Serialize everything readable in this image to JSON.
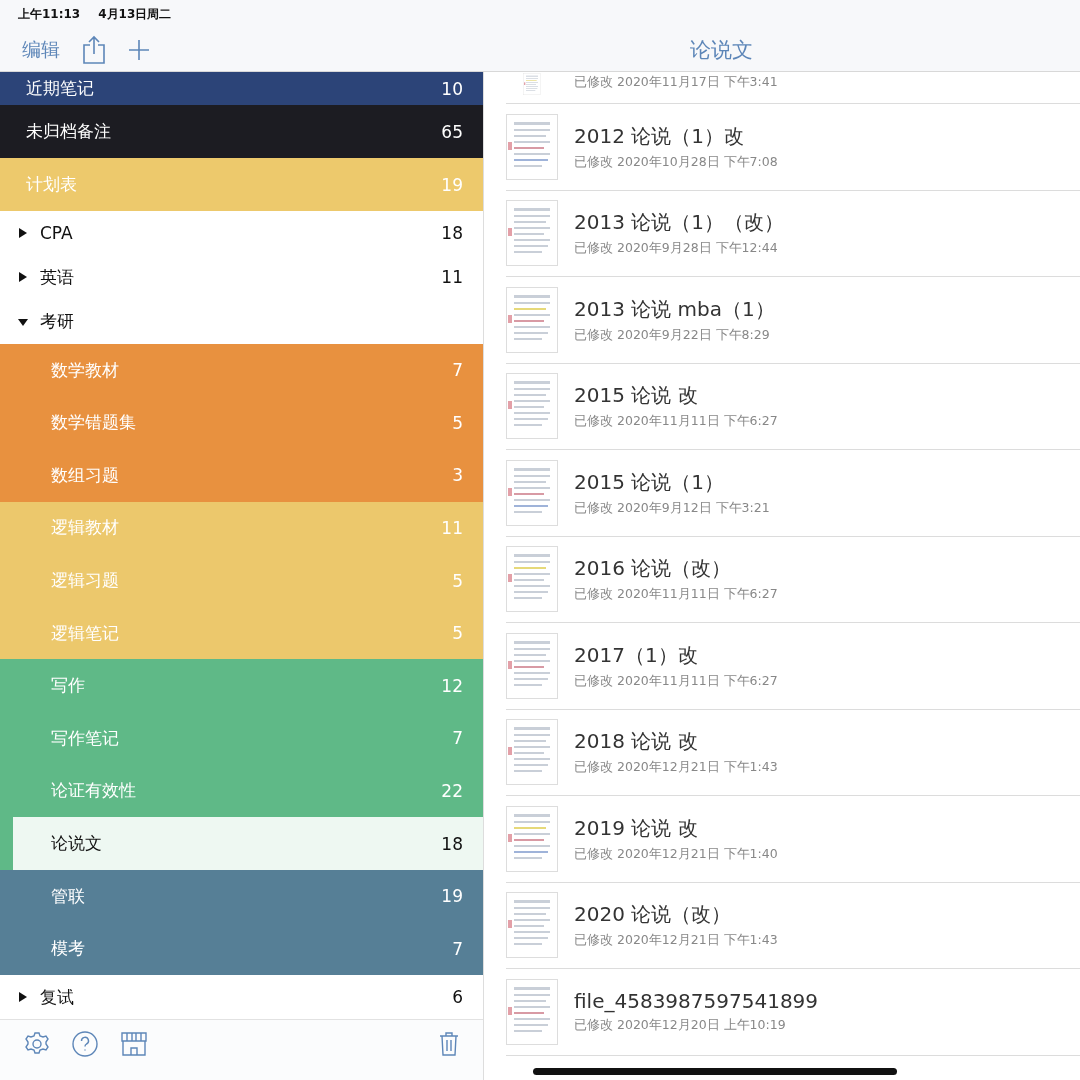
{
  "status_bar": {
    "time": "上午11:13",
    "date": "4月13日周二"
  },
  "toolbar": {
    "edit": "编辑",
    "title": "论说文"
  },
  "sidebar": {
    "items": [
      {
        "kind": "tag",
        "label": "近期笔记",
        "count": "10",
        "color": "#2c4478",
        "selected": false
      },
      {
        "kind": "tag",
        "label": "未归档备注",
        "count": "65",
        "color": "#1c1c22",
        "selected": false
      },
      {
        "kind": "tag",
        "label": "计划表",
        "count": "19",
        "color": "#edc96c",
        "selected": false
      },
      {
        "kind": "folder",
        "label": "CPA",
        "count": "18",
        "expanded": false,
        "selected": false
      },
      {
        "kind": "folder",
        "label": "英语",
        "count": "11",
        "expanded": false,
        "selected": false
      },
      {
        "kind": "folder",
        "label": "考研",
        "expanded": true,
        "selected": false,
        "children": [
          {
            "label": "数学教材",
            "count": "7",
            "color": "#e8913f",
            "selected": false
          },
          {
            "label": "数学错题集",
            "count": "5",
            "color": "#e8913f",
            "selected": false
          },
          {
            "label": "数组习题",
            "count": "3",
            "color": "#e8913f",
            "selected": false
          },
          {
            "label": "逻辑教材",
            "count": "11",
            "color": "#ecc86c",
            "selected": false
          },
          {
            "label": "逻辑习题",
            "count": "5",
            "color": "#ecc86c",
            "selected": false
          },
          {
            "label": "逻辑笔记",
            "count": "5",
            "color": "#ecc86c",
            "selected": false
          },
          {
            "label": "写作",
            "count": "12",
            "color": "#5fb987",
            "selected": false
          },
          {
            "label": "写作笔记",
            "count": "7",
            "color": "#5fb987",
            "selected": false
          },
          {
            "label": "论证有效性",
            "count": "22",
            "color": "#5fb987",
            "selected": false
          },
          {
            "label": "论说文",
            "count": "18",
            "color": "#5fb987",
            "selected": true
          },
          {
            "label": "管联",
            "count": "19",
            "color": "#567f96",
            "selected": false
          },
          {
            "label": "模考",
            "count": "7",
            "color": "#567f96",
            "selected": false
          }
        ]
      },
      {
        "kind": "folder",
        "label": "复试",
        "count": "6",
        "expanded": false,
        "selected": false
      }
    ]
  },
  "notes": [
    {
      "modified": "已修改 2020年11月17日 下午3:41"
    },
    {
      "title": "2012 论说（1）改",
      "modified": "已修改 2020年10月28日 下午7:08"
    },
    {
      "title": "2013 论说（1）（改）",
      "modified": "已修改 2020年9月28日 下午12:44"
    },
    {
      "title": "2013 论说 mba（1）",
      "modified": "已修改 2020年9月22日 下午8:29"
    },
    {
      "title": "2015 论说 改",
      "modified": "已修改 2020年11月11日 下午6:27"
    },
    {
      "title": "2015 论说（1）",
      "modified": "已修改 2020年9月12日 下午3:21"
    },
    {
      "title": "2016 论说（改）",
      "modified": "已修改 2020年11月11日 下午6:27"
    },
    {
      "title": "2017（1）改",
      "modified": "已修改 2020年11月11日 下午6:27"
    },
    {
      "title": "2018 论说 改",
      "modified": "已修改 2020年12月21日 下午1:43"
    },
    {
      "title": "2019 论说 改",
      "modified": "已修改 2020年12月21日 下午1:40"
    },
    {
      "title": "2020 论说（改）",
      "modified": "已修改 2020年12月21日 下午1:43"
    },
    {
      "title": "file_4583987597541899",
      "modified": "已修改 2020年12月20日 上午10:19"
    }
  ]
}
